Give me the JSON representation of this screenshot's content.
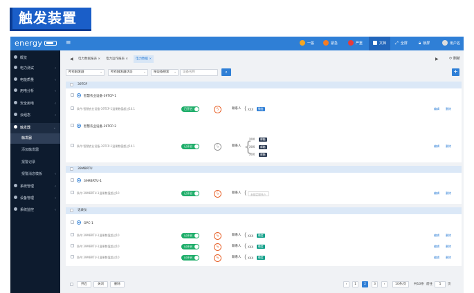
{
  "banner_title": "触发装置",
  "app": {
    "logo": "energy",
    "menu_icon": "≡",
    "top_items": [
      {
        "label": "一般",
        "color": "#f5a623"
      },
      {
        "label": "紧急",
        "color": "#f57c23"
      },
      {
        "label": "严重",
        "color": "#e83b3b"
      },
      {
        "label": "文档",
        "color": "#ffffff"
      },
      {
        "label": "全屏",
        "color": "#ffffff"
      },
      {
        "label": "锁屏",
        "color": "#ffffff"
      },
      {
        "label": "用户名",
        "color": "#dddddd"
      }
    ]
  },
  "sidebar": {
    "items": [
      {
        "label": "概览"
      },
      {
        "label": "电力测试",
        "arrow": "‹"
      },
      {
        "label": "电能质量",
        "arrow": "‹"
      },
      {
        "label": "用电分析",
        "arrow": "‹"
      },
      {
        "label": "安全用电",
        "arrow": "‹"
      },
      {
        "label": "云组态",
        "arrow": "‹"
      },
      {
        "label": "触发器",
        "arrow": "⌄"
      },
      {
        "label": "触发器"
      },
      {
        "label": "添加触发器"
      },
      {
        "label": "报警记录"
      },
      {
        "label": "报警消息模板",
        "arrow": "‹"
      },
      {
        "label": "系统管理",
        "arrow": "‹"
      },
      {
        "label": "设备管理",
        "arrow": "‹"
      },
      {
        "label": "系统监控",
        "arrow": "‹"
      }
    ]
  },
  "tabs": {
    "back": "◀",
    "items": [
      "电力数据报表 ×",
      "电力运作报表 ×",
      "电力数据 ×"
    ],
    "forward": "▶",
    "refresh": "⟳ 刷新"
  },
  "filters": {
    "f1": "所有触发器",
    "f2": "所有触发器状态",
    "f3": "按设备搜索",
    "f4": "设备名称",
    "search_icon": "⌕",
    "add_icon": "+"
  },
  "groups": [
    {
      "name": "39TCP"
    },
    {
      "name": "39MBRTU"
    },
    {
      "name": "记录仪"
    }
  ],
  "devices": [
    {
      "name": "智慧农业设备-39TCP-1"
    },
    {
      "name": "智慧农业设备-39TCP-2"
    },
    {
      "name": "39MBRTU-1"
    },
    {
      "name": "OPC-1"
    }
  ],
  "triggers": [
    {
      "condition": "条件:智慧农业设备-39TCP-1温果数值超过10.1",
      "status": "已开启",
      "contact": "联系人",
      "values": [
        "XXX"
      ],
      "badges": [
        "微信"
      ]
    },
    {
      "condition": "条件:智慧农业设备-39TCP-1温果数值超过10.1",
      "status": "已开启",
      "contact": "联系人",
      "values": [
        "XXX",
        "XXX",
        "XXX"
      ],
      "badges": [
        "邮箱",
        "邮箱",
        "邮箱"
      ]
    },
    {
      "condition": "条件:39MBRTU-1温果数值超过10",
      "status": "已开启",
      "contact": "联系人",
      "placeholder": "未绑定联系人"
    },
    {
      "condition": "条件:39MBRTU-1温果数值超过10",
      "status": "已开启",
      "contact": "联系人",
      "values": [
        "XXX"
      ],
      "badges": [
        "微信"
      ]
    },
    {
      "condition": "条件:39MBRTU-1温果数值超过10",
      "status": "已开启",
      "contact": "联系人",
      "values": [
        "XXX"
      ],
      "badges": [
        "微信"
      ]
    },
    {
      "condition": "条件:39MBRTU-1温果数值超过10",
      "status": "已开启",
      "contact": "联系人",
      "values": [
        "XXX"
      ],
      "badges": [
        "微信"
      ]
    }
  ],
  "row_actions": {
    "edit": "编辑",
    "delete": "删除"
  },
  "bolt_icon": "ϟ",
  "footer": {
    "enable": "开启",
    "disable": "关闭",
    "delete": "删除",
    "prev": "‹",
    "pages": [
      "1",
      "2",
      "3"
    ],
    "current_page": "2",
    "next": "›",
    "page_size": "10条/页",
    "total": "共10条",
    "goto_prefix": "前往",
    "goto_value": "5",
    "goto_suffix": "页"
  }
}
